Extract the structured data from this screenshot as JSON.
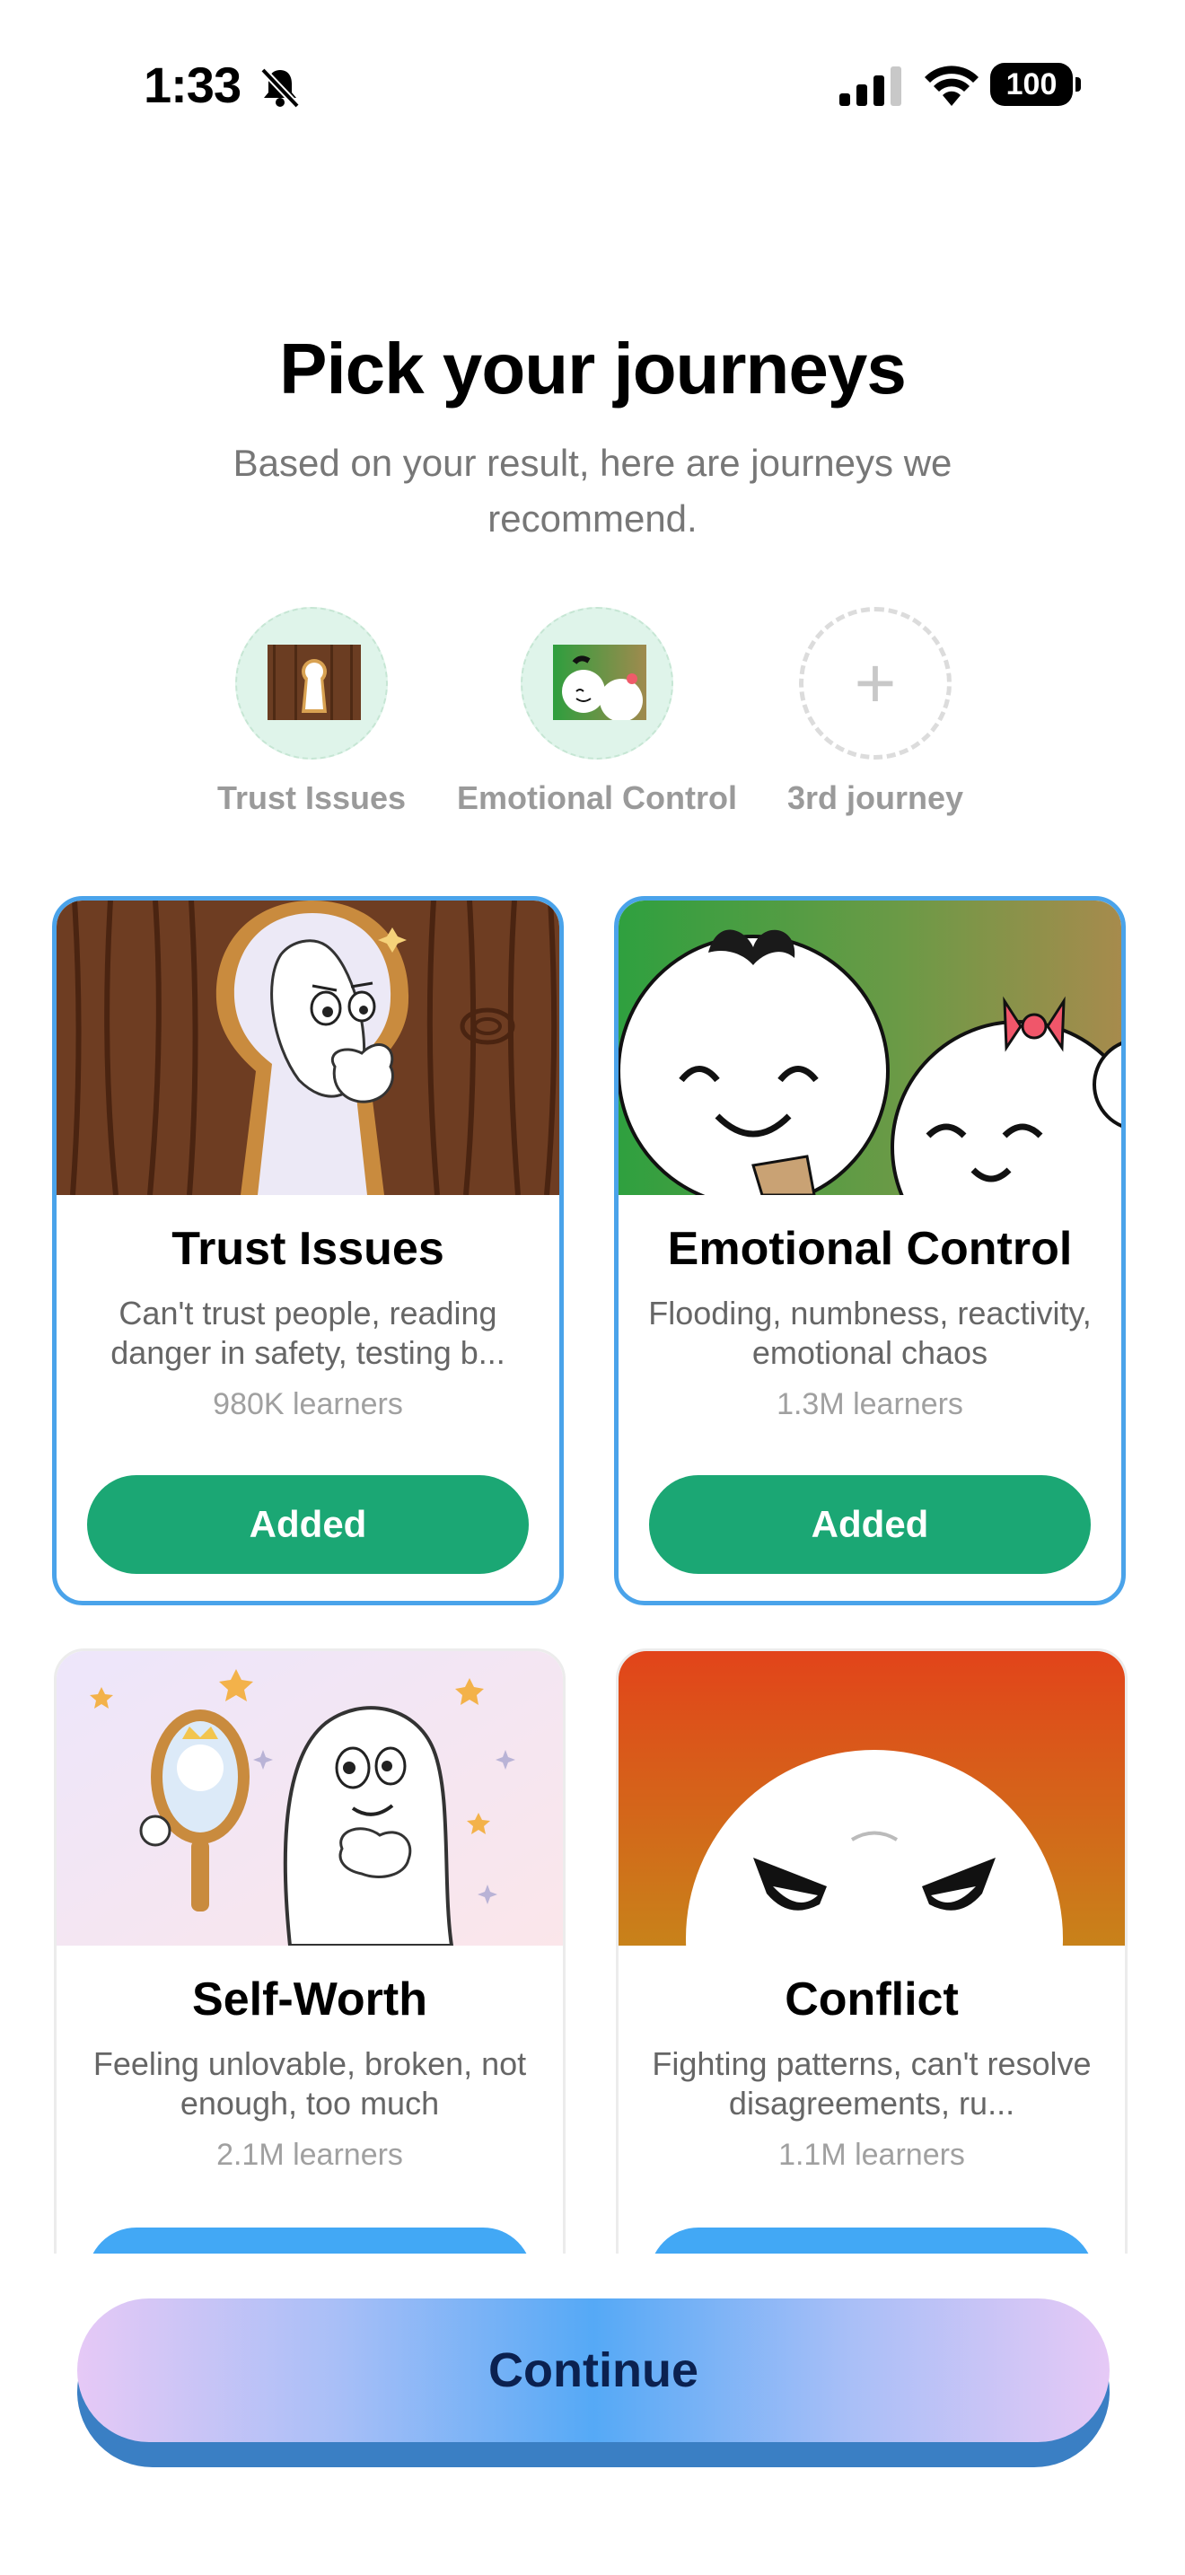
{
  "status_bar": {
    "time": "1:33",
    "battery": "100"
  },
  "header": {
    "title": "Pick your journeys",
    "subtitle": "Based on your result, here are journeys we recommend."
  },
  "slots": [
    {
      "label": "Trust Issues",
      "state": "filled"
    },
    {
      "label": "Emotional Control",
      "state": "filled"
    },
    {
      "label": "3rd journey",
      "state": "empty"
    }
  ],
  "cards": [
    {
      "name": "Trust Issues",
      "desc": "Can't trust people, reading danger in safety, testing b...",
      "count": "980K learners",
      "button": "Added",
      "selected": true
    },
    {
      "name": "Emotional Control",
      "desc": "Flooding, numbness, reactivity, emotional chaos",
      "count": "1.3M learners",
      "button": "Added",
      "selected": true
    },
    {
      "name": "Self-Worth",
      "desc": "Feeling unlovable, broken, not enough, too much",
      "count": "2.1M learners",
      "button": "",
      "selected": false
    },
    {
      "name": "Conflict",
      "desc": "Fighting patterns, can't resolve disagreements, ru...",
      "count": "1.1M learners",
      "button": "",
      "selected": false
    }
  ],
  "continue_label": "Continue",
  "colors": {
    "added": "#1ba774",
    "selected_border": "#4aa3ea",
    "add": "#42a8f5"
  }
}
